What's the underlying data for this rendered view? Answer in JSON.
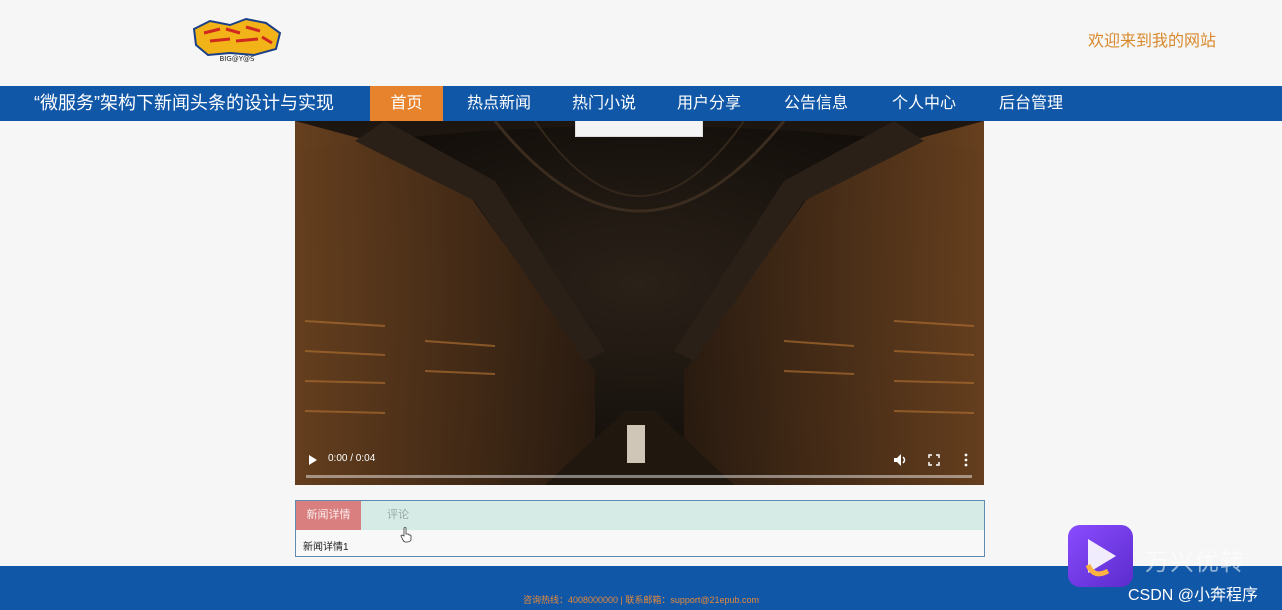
{
  "header": {
    "logo_text": "BIG@Y@S",
    "welcome": "欢迎来到我的网站"
  },
  "nav": {
    "site_title": "“微服务”架构下新闻头条的设计与实现",
    "items": [
      {
        "label": "首页",
        "active": true
      },
      {
        "label": "热点新闻",
        "active": false
      },
      {
        "label": "热门小说",
        "active": false
      },
      {
        "label": "用户分享",
        "active": false
      },
      {
        "label": "公告信息",
        "active": false
      },
      {
        "label": "个人中心",
        "active": false
      },
      {
        "label": "后台管理",
        "active": false
      }
    ]
  },
  "video": {
    "time": "0:00 / 0:04",
    "progress": 0.0,
    "controls": [
      "play-icon",
      "volume-icon",
      "fullscreen-icon",
      "more-options-icon"
    ]
  },
  "tabs": {
    "items": [
      {
        "label": "新闻详情",
        "active": true
      },
      {
        "label": "评论",
        "active": false
      }
    ],
    "content": "新闻详情1"
  },
  "footer": {
    "text": "咨询热线：4008000000 | 联系邮箱：support@21epub.com"
  },
  "watermark": {
    "brand": "万兴优转",
    "csdn": "CSDN @小奔程序"
  },
  "colors": {
    "nav_bg": "#1157a7",
    "nav_active": "#e7822d",
    "welcome_text": "#d9892d",
    "tab_active": "#d97f7f",
    "tab_bar": "#d6ebe6"
  }
}
